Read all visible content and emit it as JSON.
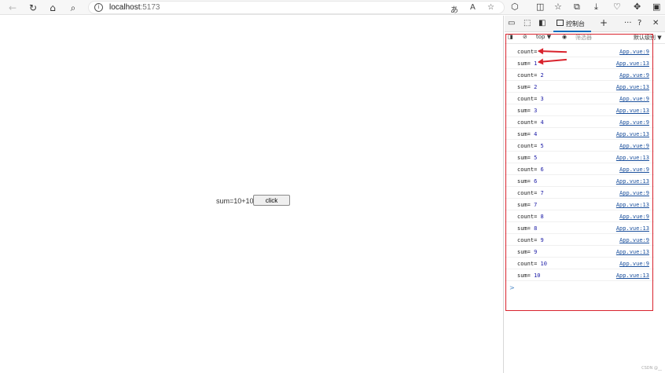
{
  "browser": {
    "url_host": "localhost",
    "url_port": ":5173",
    "back_icon": "back-arrow-icon",
    "reload_icon": "reload-icon",
    "home_icon": "home-icon",
    "search_icon": "search-icon"
  },
  "page": {
    "sum_text": "sum=10+10",
    "button_label": "click"
  },
  "devtools": {
    "active_tab": "控制台",
    "context": "top",
    "filter_placeholder": "筛选器",
    "levels": "默认级别",
    "prompt": ">"
  },
  "console_logs": [
    {
      "label": "count=",
      "value": "1",
      "source": "App.vue:9"
    },
    {
      "label": "sum=",
      "value": "1",
      "source": "App.vue:13"
    },
    {
      "label": "count=",
      "value": "2",
      "source": "App.vue:9"
    },
    {
      "label": "sum=",
      "value": "2",
      "source": "App.vue:13"
    },
    {
      "label": "count=",
      "value": "3",
      "source": "App.vue:9"
    },
    {
      "label": "sum=",
      "value": "3",
      "source": "App.vue:13"
    },
    {
      "label": "count=",
      "value": "4",
      "source": "App.vue:9"
    },
    {
      "label": "sum=",
      "value": "4",
      "source": "App.vue:13"
    },
    {
      "label": "count=",
      "value": "5",
      "source": "App.vue:9"
    },
    {
      "label": "sum=",
      "value": "5",
      "source": "App.vue:13"
    },
    {
      "label": "count=",
      "value": "6",
      "source": "App.vue:9"
    },
    {
      "label": "sum=",
      "value": "6",
      "source": "App.vue:13"
    },
    {
      "label": "count=",
      "value": "7",
      "source": "App.vue:9"
    },
    {
      "label": "sum=",
      "value": "7",
      "source": "App.vue:13"
    },
    {
      "label": "count=",
      "value": "8",
      "source": "App.vue:9"
    },
    {
      "label": "sum=",
      "value": "8",
      "source": "App.vue:13"
    },
    {
      "label": "count=",
      "value": "9",
      "source": "App.vue:9"
    },
    {
      "label": "sum=",
      "value": "9",
      "source": "App.vue:13"
    },
    {
      "label": "count=",
      "value": "10",
      "source": "App.vue:9"
    },
    {
      "label": "sum=",
      "value": "10",
      "source": "App.vue:13"
    }
  ],
  "colors": {
    "highlight": "#d9232d",
    "link": "#1a4f9c",
    "number": "#1a1aa6",
    "tab_accent": "#0f6cbd"
  }
}
